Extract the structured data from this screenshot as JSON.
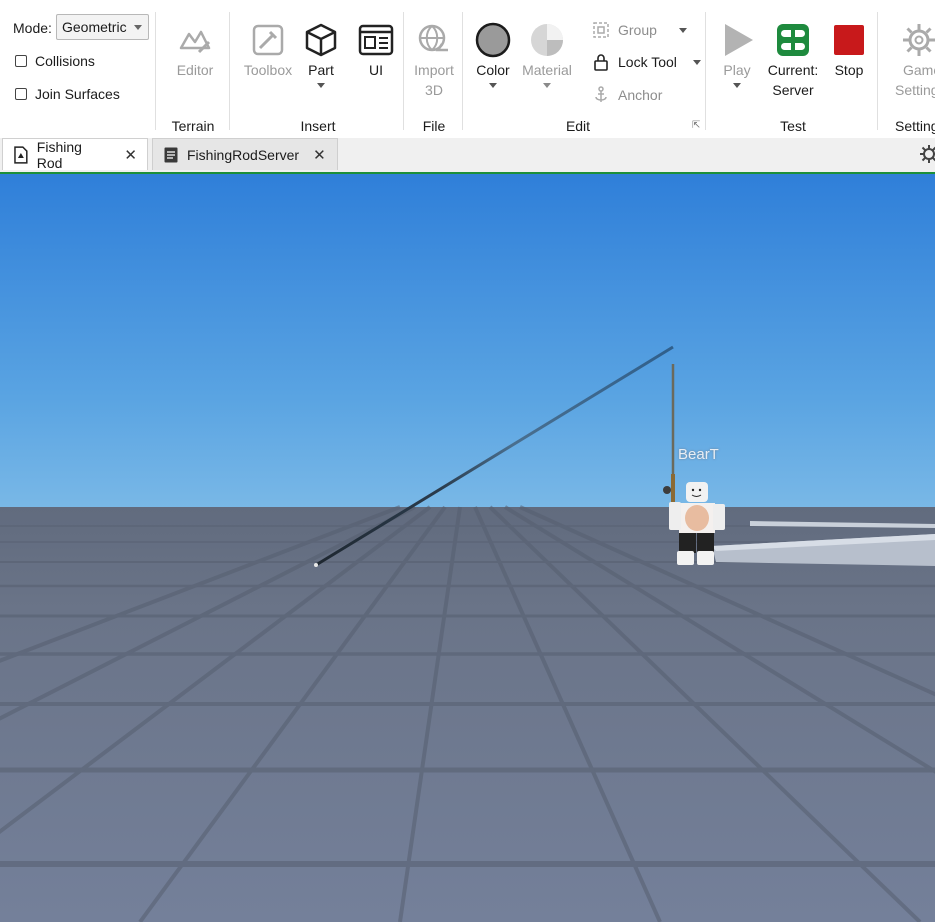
{
  "mode": {
    "label": "Mode:",
    "value": "Geometric"
  },
  "options": {
    "collisions": "Collisions",
    "join_surfaces": "Join Surfaces"
  },
  "terrain": {
    "editor": "Editor",
    "group": "Terrain"
  },
  "insert": {
    "toolbox": "Toolbox",
    "part": "Part",
    "ui": "UI",
    "group": "Insert"
  },
  "file": {
    "import_line1": "Import",
    "import_line2": "3D",
    "group": "File"
  },
  "edit": {
    "color": "Color",
    "material": "Material",
    "group_btn": "Group",
    "lock_tool": "Lock Tool",
    "anchor": "Anchor",
    "group": "Edit"
  },
  "test": {
    "play": "Play",
    "current_line1": "Current:",
    "current_line2": "Server",
    "stop": "Stop",
    "group": "Test"
  },
  "settings": {
    "game_line1": "Game",
    "game_line2": "Settings",
    "group": "Settings"
  },
  "tabs": [
    {
      "label": "Fishing Rod",
      "icon": "place-file-icon",
      "active": true
    },
    {
      "label": "FishingRodServer",
      "icon": "script-icon",
      "active": false
    }
  ],
  "viewport": {
    "player_name": "BearT"
  },
  "colors": {
    "accent_green": "#1d8f3a",
    "stop_red": "#c8191b",
    "server_green": "#1e8a3e"
  }
}
